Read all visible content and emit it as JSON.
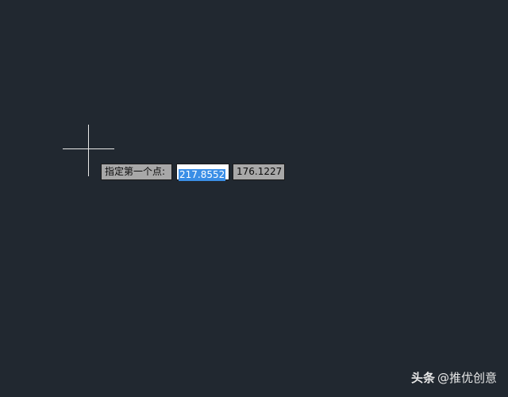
{
  "drawing_area": {
    "background_color": "#212830"
  },
  "dynamic_input": {
    "prompt": "指定第一个点:",
    "x_value": "217.8552",
    "y_value": "176.1227",
    "selection_color": "#3a8ee6"
  },
  "cursor": {
    "icon": "crosshair-icon"
  },
  "watermark": {
    "brand": "头条",
    "handle": "@推优创意"
  }
}
